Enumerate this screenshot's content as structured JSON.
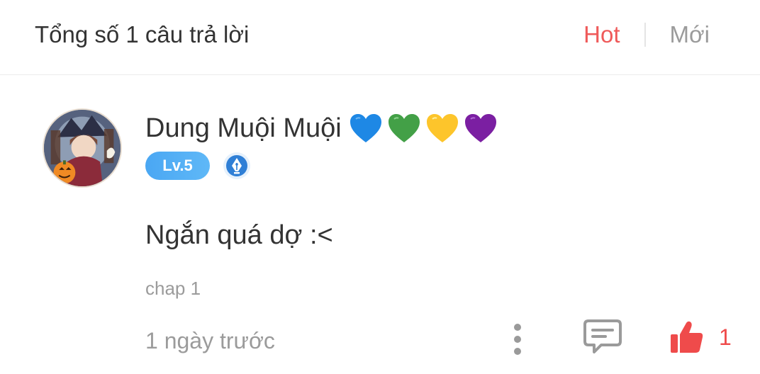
{
  "header": {
    "title": "Tổng số 1 câu trả lời",
    "sort_hot": "Hot",
    "sort_new": "Mới"
  },
  "comment": {
    "username": "Dung Muội Muội",
    "hearts": [
      "blue-heart",
      "green-heart",
      "yellow-heart",
      "purple-heart"
    ],
    "level": "Lv.5",
    "text": "Ngắn quá dợ :<",
    "chapter": "chap 1",
    "time": "1 ngày trước",
    "likes": "1"
  },
  "colors": {
    "hot": "#ef5a5a",
    "like": "#ef4b4b",
    "level_badge": "#4aa7f3",
    "heart_blue": "#1e88e5",
    "heart_green": "#43a047",
    "heart_yellow": "#fdd835",
    "heart_purple": "#7b1fa2"
  }
}
